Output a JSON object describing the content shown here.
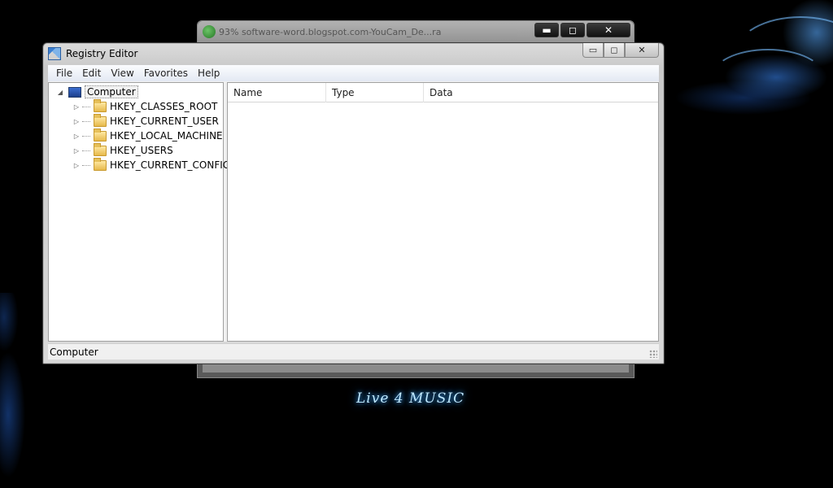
{
  "desktop": {
    "wallpaper_text": "Live 4 MUSIC"
  },
  "background_window": {
    "title": "93% software-word.blogspot.com-YouCam_De...ra",
    "controls": {
      "min": "▬",
      "max": "◻",
      "close": "✕"
    }
  },
  "regedit": {
    "title": "Registry Editor",
    "controls": {
      "min": "▭",
      "max": "◻",
      "close": "✕"
    },
    "menu": [
      "File",
      "Edit",
      "View",
      "Favorites",
      "Help"
    ],
    "tree": {
      "root": "Computer",
      "keys": [
        "HKEY_CLASSES_ROOT",
        "HKEY_CURRENT_USER",
        "HKEY_LOCAL_MACHINE",
        "HKEY_USERS",
        "HKEY_CURRENT_CONFIG"
      ]
    },
    "columns": [
      "Name",
      "Type",
      "Data"
    ],
    "status": "Computer"
  }
}
